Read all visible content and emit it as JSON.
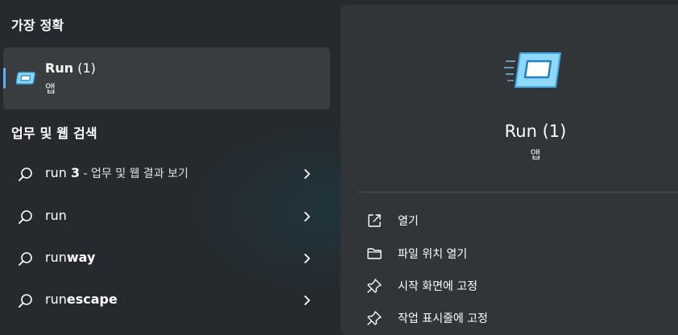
{
  "best_match": {
    "heading": "가장 정확",
    "title": "Run",
    "count": "(1)",
    "type": "앱",
    "icon": "run-app-icon",
    "accent_color": "#5fb2f2"
  },
  "web_search": {
    "heading": "업무 및 웹 검색",
    "results": [
      {
        "prefix": "run ",
        "bold": "3",
        "suffix": " - 업무 및 웹 결과 보기"
      },
      {
        "prefix": "run",
        "bold": "",
        "suffix": ""
      },
      {
        "prefix": "run",
        "bold": "way",
        "suffix": ""
      },
      {
        "prefix": "run",
        "bold": "escape",
        "suffix": ""
      }
    ]
  },
  "detail": {
    "title": "Run (1)",
    "type": "앱",
    "icon": "run-app-icon",
    "actions": [
      {
        "label": "열기",
        "icon": "open-external-icon"
      },
      {
        "label": "파일 위치 열기",
        "icon": "folder-icon"
      },
      {
        "label": "시작 화면에 고정",
        "icon": "pin-icon"
      },
      {
        "label": "작업 표시줄에 고정",
        "icon": "pin-icon"
      }
    ]
  }
}
